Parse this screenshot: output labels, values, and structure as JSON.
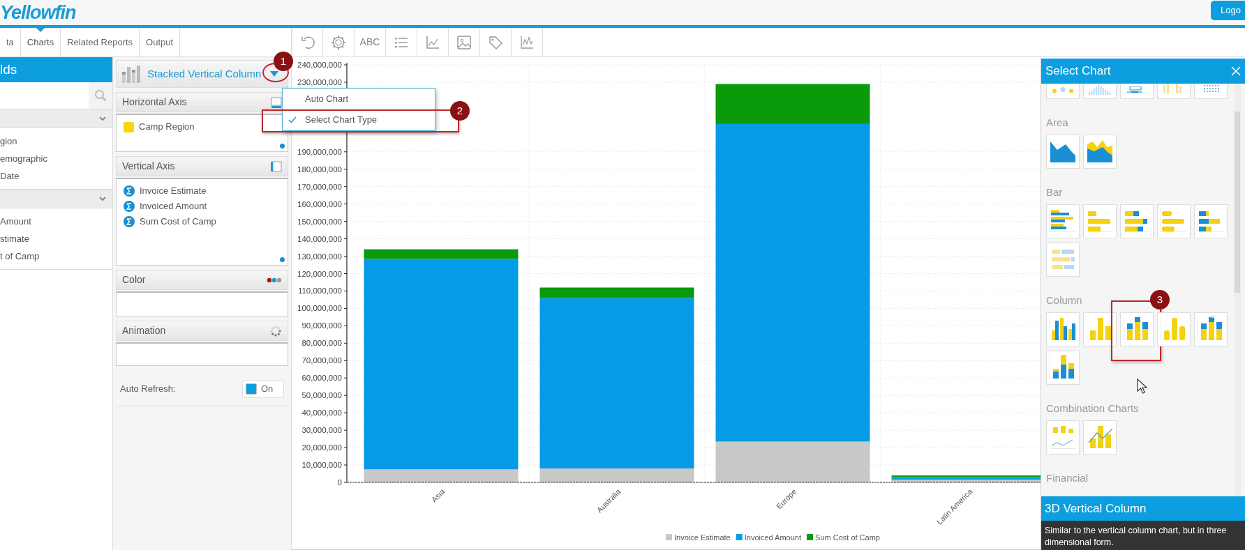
{
  "header": {
    "logo": "Yellowfin",
    "logout_button": "Logo"
  },
  "tabs": [
    {
      "label": "ta",
      "selected": false
    },
    {
      "label": "Charts",
      "selected": true
    },
    {
      "label": "Related Reports",
      "selected": false
    },
    {
      "label": "Output",
      "selected": false
    }
  ],
  "toolbar": [
    {
      "kind": "undo"
    },
    {
      "kind": "settings"
    },
    {
      "kind": "text",
      "label": "ABC"
    },
    {
      "kind": "list"
    },
    {
      "kind": "axes"
    },
    {
      "kind": "image"
    },
    {
      "kind": "tag"
    },
    {
      "kind": "line"
    }
  ],
  "fields_panel": {
    "title": "lds",
    "groups": [
      {
        "expanded": true,
        "items": [
          "gion",
          "emographic",
          "Date"
        ]
      },
      {
        "expanded": true,
        "items": [
          "Amount",
          "stimate",
          "t of Camp"
        ]
      }
    ]
  },
  "chart_type": {
    "label": "Stacked Vertical Column",
    "callout": "1"
  },
  "chart_menu": {
    "items": [
      {
        "label": "Auto Chart",
        "checked": false
      },
      {
        "label": "Select Chart Type",
        "checked": true,
        "callout": "2"
      }
    ]
  },
  "drop_zones": [
    {
      "kind": "horizontal-axis",
      "title": "Horizontal Axis",
      "fields": [
        {
          "kind": "dimension",
          "label": "Camp Region"
        }
      ]
    },
    {
      "kind": "vertical-axis",
      "title": "Vertical Axis",
      "fields": [
        {
          "kind": "metric",
          "label": "Invoice Estimate"
        },
        {
          "kind": "metric",
          "label": "Invoiced Amount"
        },
        {
          "kind": "metric",
          "label": "Sum Cost of Camp"
        }
      ]
    },
    {
      "kind": "color",
      "title": "Color"
    },
    {
      "kind": "animation",
      "title": "Animation"
    }
  ],
  "auto_refresh": {
    "label": "Auto Refresh:",
    "on": true,
    "state_text": "On"
  },
  "chart": {
    "chart_data": {
      "type": "bar",
      "stacked": true,
      "orientation": "vertical",
      "categories": [
        "Asia",
        "Australia",
        "Europe",
        "Latin America"
      ],
      "series": [
        {
          "name": "Invoice Estimate",
          "color": "#c8c8c8",
          "values": [
            7500000,
            8000000,
            23500000,
            1500000
          ]
        },
        {
          "name": "Invoiced Amount",
          "color": "#069be6",
          "values": [
            121000000,
            98000000,
            182500000,
            1500000
          ]
        },
        {
          "name": "Sum Cost of Camp",
          "color": "#0a9a0a",
          "values": [
            5500000,
            6000000,
            23000000,
            1000000
          ]
        }
      ],
      "ylim": [
        0,
        240000000
      ],
      "grid": true,
      "legend": true,
      "yticks": [
        {
          "value": 0,
          "label": "0"
        },
        {
          "value": 10000000,
          "label": "10,000,000"
        },
        {
          "value": 20000000,
          "label": "20,000,000"
        },
        {
          "value": 30000000,
          "label": "30,000,000"
        },
        {
          "value": 40000000,
          "label": "40,000,000"
        },
        {
          "value": 50000000,
          "label": "50,000,000"
        },
        {
          "value": 60000000,
          "label": "60,000,000"
        },
        {
          "value": 70000000,
          "label": "70,000,000"
        },
        {
          "value": 80000000,
          "label": "80,000,000"
        },
        {
          "value": 90000000,
          "label": "90,000,000"
        },
        {
          "value": 100000000,
          "label": "100,000,000"
        },
        {
          "value": 110000000,
          "label": "110,000,000"
        },
        {
          "value": 120000000,
          "label": "120,000,000"
        },
        {
          "value": 130000000,
          "label": "130,000,000"
        },
        {
          "value": 140000000,
          "label": "140,000,000"
        },
        {
          "value": 150000000,
          "label": "150,000,000"
        },
        {
          "value": 160000000,
          "label": "160,000,000"
        },
        {
          "value": 170000000,
          "label": "170,000,000"
        },
        {
          "value": 180000000,
          "label": "180,000,000"
        },
        {
          "value": 190000000,
          "label": "190,000,000"
        },
        {
          "value": 230000000,
          "label": "230,000,000"
        },
        {
          "value": 240000000,
          "label": "240,000,000"
        }
      ]
    }
  },
  "select_chart_panel": {
    "title": "Select Chart",
    "sections": [
      {
        "items": [
          {
            "kind": "scatter"
          },
          {
            "kind": "histogram"
          },
          {
            "kind": "box"
          },
          {
            "kind": "column-light"
          },
          {
            "kind": "dot-grid"
          }
        ]
      },
      {
        "title": "Area",
        "items": [
          {
            "kind": "area"
          },
          {
            "kind": "stacked-area"
          }
        ]
      },
      {
        "title": "Bar",
        "items": [
          {
            "kind": "bar-clustered"
          },
          {
            "kind": "bar"
          },
          {
            "kind": "bar-stacked"
          },
          {
            "kind": "bar-rounded"
          },
          {
            "kind": "bar-stacked-blue"
          },
          {
            "kind": "bar-light"
          }
        ]
      },
      {
        "title": "Column",
        "items": [
          {
            "kind": "column-clustered"
          },
          {
            "kind": "column"
          },
          {
            "kind": "column-stacked",
            "callout": "3"
          },
          {
            "kind": "column-rounded"
          },
          {
            "kind": "column-stacked-blue"
          },
          {
            "kind": "column-overlap"
          }
        ]
      },
      {
        "title": "Combination Charts",
        "items": [
          {
            "kind": "combo-line"
          },
          {
            "kind": "combo-bar-line"
          }
        ]
      },
      {
        "title": "Financial"
      }
    ]
  },
  "tooltip": {
    "title": "3D Vertical Column",
    "description": "Similar to the vertical column chart, but in three dimensional form."
  }
}
